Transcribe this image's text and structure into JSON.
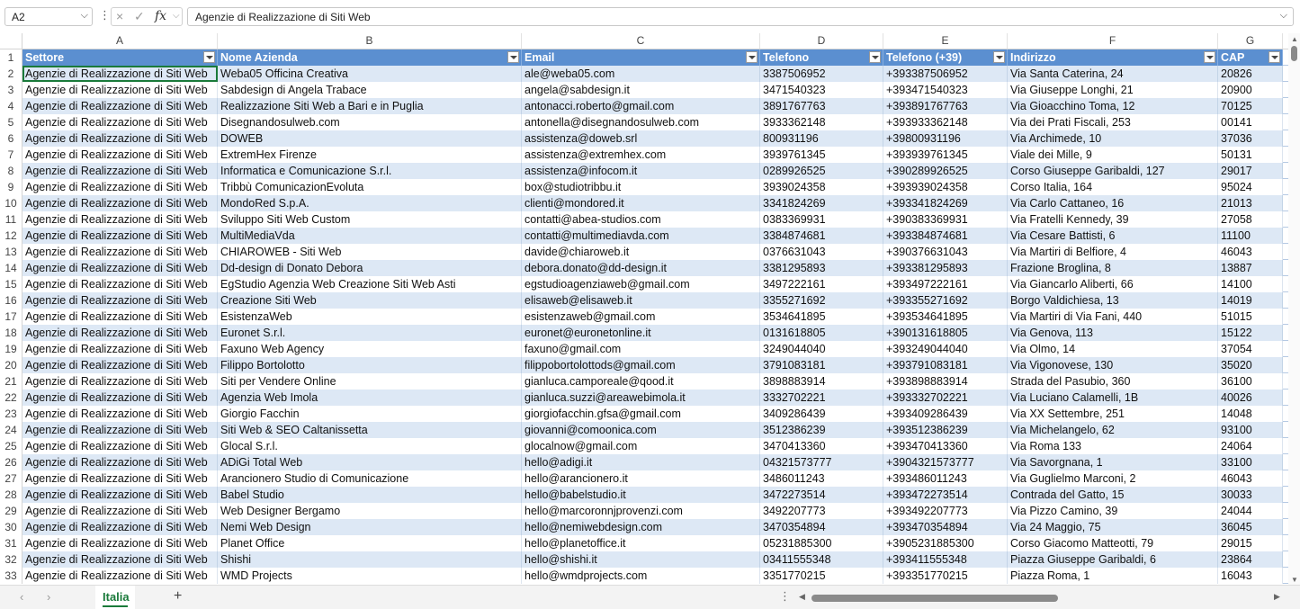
{
  "formula_bar": {
    "name_box": "A2",
    "fx": "fx",
    "content": "Agenzie di Realizzazione di Siti Web"
  },
  "columns": [
    "A",
    "B",
    "C",
    "D",
    "E",
    "F",
    "G"
  ],
  "headers": [
    "Settore",
    "Nome Azienda",
    "Email",
    "Telefono",
    "Telefono (+39)",
    "Indirizzo",
    "CAP"
  ],
  "rows": [
    [
      "Agenzie di Realizzazione di Siti Web",
      "Weba05 Officina Creativa",
      "ale@weba05.com",
      "3387506952",
      "+393387506952",
      "Via Santa Caterina, 24",
      "20826"
    ],
    [
      "Agenzie di Realizzazione di Siti Web",
      "Sabdesign di Angela Trabace",
      "angela@sabdesign.it",
      "3471540323",
      "+393471540323",
      "Via Giuseppe Longhi, 21",
      "20900"
    ],
    [
      "Agenzie di Realizzazione di Siti Web",
      "Realizzazione Siti Web a Bari e in Puglia",
      "antonacci.roberto@gmail.com",
      "3891767763",
      "+393891767763",
      "Via Gioacchino Toma, 12",
      "70125"
    ],
    [
      "Agenzie di Realizzazione di Siti Web",
      "Disegnandosulweb.com",
      "antonella@disegnandosulweb.com",
      "3933362148",
      "+393933362148",
      "Via dei Prati Fiscali, 253",
      "00141"
    ],
    [
      "Agenzie di Realizzazione di Siti Web",
      "DOWEB",
      "assistenza@doweb.srl",
      "800931196",
      "+39800931196",
      "Via Archimede, 10",
      "37036"
    ],
    [
      "Agenzie di Realizzazione di Siti Web",
      "ExtremHex Firenze",
      "assistenza@extremhex.com",
      "3939761345",
      "+393939761345",
      "Viale dei Mille, 9",
      "50131"
    ],
    [
      "Agenzie di Realizzazione di Siti Web",
      "Informatica e Comunicazione S.r.l.",
      "assistenza@infocom.it",
      "0289926525",
      "+390289926525",
      "Corso Giuseppe Garibaldi, 127",
      "29017"
    ],
    [
      "Agenzie di Realizzazione di Siti Web",
      "Tribbù ComunicazionEvoluta",
      "box@studiotribbu.it",
      "3939024358",
      "+393939024358",
      "Corso Italia, 164",
      "95024"
    ],
    [
      "Agenzie di Realizzazione di Siti Web",
      "MondoRed S.p.A.",
      "clienti@mondored.it",
      "3341824269",
      "+393341824269",
      "Via Carlo Cattaneo, 16",
      "21013"
    ],
    [
      "Agenzie di Realizzazione di Siti Web",
      "Sviluppo Siti Web Custom",
      "contatti@abea-studios.com",
      "0383369931",
      "+390383369931",
      "Via Fratelli Kennedy, 39",
      "27058"
    ],
    [
      "Agenzie di Realizzazione di Siti Web",
      "MultiMediaVda",
      "contatti@multimediavda.com",
      "3384874681",
      "+393384874681",
      "Via Cesare Battisti, 6",
      "11100"
    ],
    [
      "Agenzie di Realizzazione di Siti Web",
      "CHIAROWEB - Siti Web",
      "davide@chiaroweb.it",
      "0376631043",
      "+390376631043",
      "Via Martiri di Belfiore, 4",
      "46043"
    ],
    [
      "Agenzie di Realizzazione di Siti Web",
      "Dd-design di Donato Debora",
      "debora.donato@dd-design.it",
      "3381295893",
      "+393381295893",
      "Frazione Broglina, 8",
      "13887"
    ],
    [
      "Agenzie di Realizzazione di Siti Web",
      "EgStudio Agenzia Web Creazione Siti Web Asti",
      "egstudioagenziaweb@gmail.com",
      "3497222161",
      "+393497222161",
      "Via Giancarlo Aliberti, 66",
      "14100"
    ],
    [
      "Agenzie di Realizzazione di Siti Web",
      "Creazione Siti Web",
      "elisaweb@elisaweb.it",
      "3355271692",
      "+393355271692",
      "Borgo Valdichiesa, 13",
      "14019"
    ],
    [
      "Agenzie di Realizzazione di Siti Web",
      "EsistenzaWeb",
      "esistenzaweb@gmail.com",
      "3534641895",
      "+393534641895",
      "Via Martiri di Via Fani, 440",
      "51015"
    ],
    [
      "Agenzie di Realizzazione di Siti Web",
      "Euronet S.r.l.",
      "euronet@euronetonline.it",
      "0131618805",
      "+390131618805",
      "Via Genova, 113",
      "15122"
    ],
    [
      "Agenzie di Realizzazione di Siti Web",
      "Faxuno Web Agency",
      "faxuno@gmail.com",
      "3249044040",
      "+393249044040",
      "Via Olmo, 14",
      "37054"
    ],
    [
      "Agenzie di Realizzazione di Siti Web",
      "Filippo Bortolotto",
      "filippobortolottods@gmail.com",
      "3791083181",
      "+393791083181",
      "Via Vigonovese, 130",
      "35020"
    ],
    [
      "Agenzie di Realizzazione di Siti Web",
      "Siti per Vendere Online",
      "gianluca.camporeale@qood.it",
      "3898883914",
      "+393898883914",
      "Strada del Pasubio, 360",
      "36100"
    ],
    [
      "Agenzie di Realizzazione di Siti Web",
      "Agenzia Web Imola",
      "gianluca.suzzi@areawebimola.it",
      "3332702221",
      "+393332702221",
      "Via Luciano Calamelli, 1B",
      "40026"
    ],
    [
      "Agenzie di Realizzazione di Siti Web",
      "Giorgio Facchin",
      "giorgiofacchin.gfsa@gmail.com",
      "3409286439",
      "+393409286439",
      "Via XX Settembre, 251",
      "14048"
    ],
    [
      "Agenzie di Realizzazione di Siti Web",
      "Siti Web & SEO Caltanissetta",
      "giovanni@comoonica.com",
      "3512386239",
      "+393512386239",
      "Via Michelangelo, 62",
      "93100"
    ],
    [
      "Agenzie di Realizzazione di Siti Web",
      "Glocal S.r.l.",
      "glocalnow@gmail.com",
      "3470413360",
      "+393470413360",
      "Via Roma 133",
      "24064"
    ],
    [
      "Agenzie di Realizzazione di Siti Web",
      "ADiGi Total Web",
      "hello@adigi.it",
      "04321573777",
      "+3904321573777",
      "Via Savorgnana, 1",
      "33100"
    ],
    [
      "Agenzie di Realizzazione di Siti Web",
      "Arancionero Studio di Comunicazione",
      "hello@arancionero.it",
      "3486011243",
      "+393486011243",
      "Via Guglielmo Marconi, 2",
      "46043"
    ],
    [
      "Agenzie di Realizzazione di Siti Web",
      "Babel Studio",
      "hello@babelstudio.it",
      "3472273514",
      "+393472273514",
      "Contrada del Gatto, 15",
      "30033"
    ],
    [
      "Agenzie di Realizzazione di Siti Web",
      "Web Designer Bergamo",
      "hello@marcoronnjprovenzi.com",
      "3492207773",
      "+393492207773",
      "Via Pizzo Camino, 39",
      "24044"
    ],
    [
      "Agenzie di Realizzazione di Siti Web",
      "Nemi Web Design",
      "hello@nemiwebdesign.com",
      "3470354894",
      "+393470354894",
      "Via 24 Maggio, 75",
      "36045"
    ],
    [
      "Agenzie di Realizzazione di Siti Web",
      "Planet Office",
      "hello@planetoffice.it",
      "05231885300",
      "+3905231885300",
      "Corso Giacomo Matteotti, 79",
      "29015"
    ],
    [
      "Agenzie di Realizzazione di Siti Web",
      "Shishi",
      "hello@shishi.it",
      "03411555348",
      "+393411555348",
      "Piazza Giuseppe Garibaldi, 6",
      "23864"
    ],
    [
      "Agenzie di Realizzazione di Siti Web",
      "WMD Projects",
      "hello@wmdprojects.com",
      "3351770215",
      "+393351770215",
      "Piazza Roma, 1",
      "16043"
    ]
  ],
  "sheet_tabs": [
    {
      "label": "Italia",
      "active": true
    }
  ],
  "icons": {
    "cancel": "×",
    "enter": "✓",
    "add_sheet": "+",
    "prev": "‹",
    "next": "›",
    "more": "⋮"
  },
  "colors": {
    "header_bg": "#5b8fd0",
    "band_bg": "#dde8f5",
    "accent": "#1a7a3a"
  }
}
